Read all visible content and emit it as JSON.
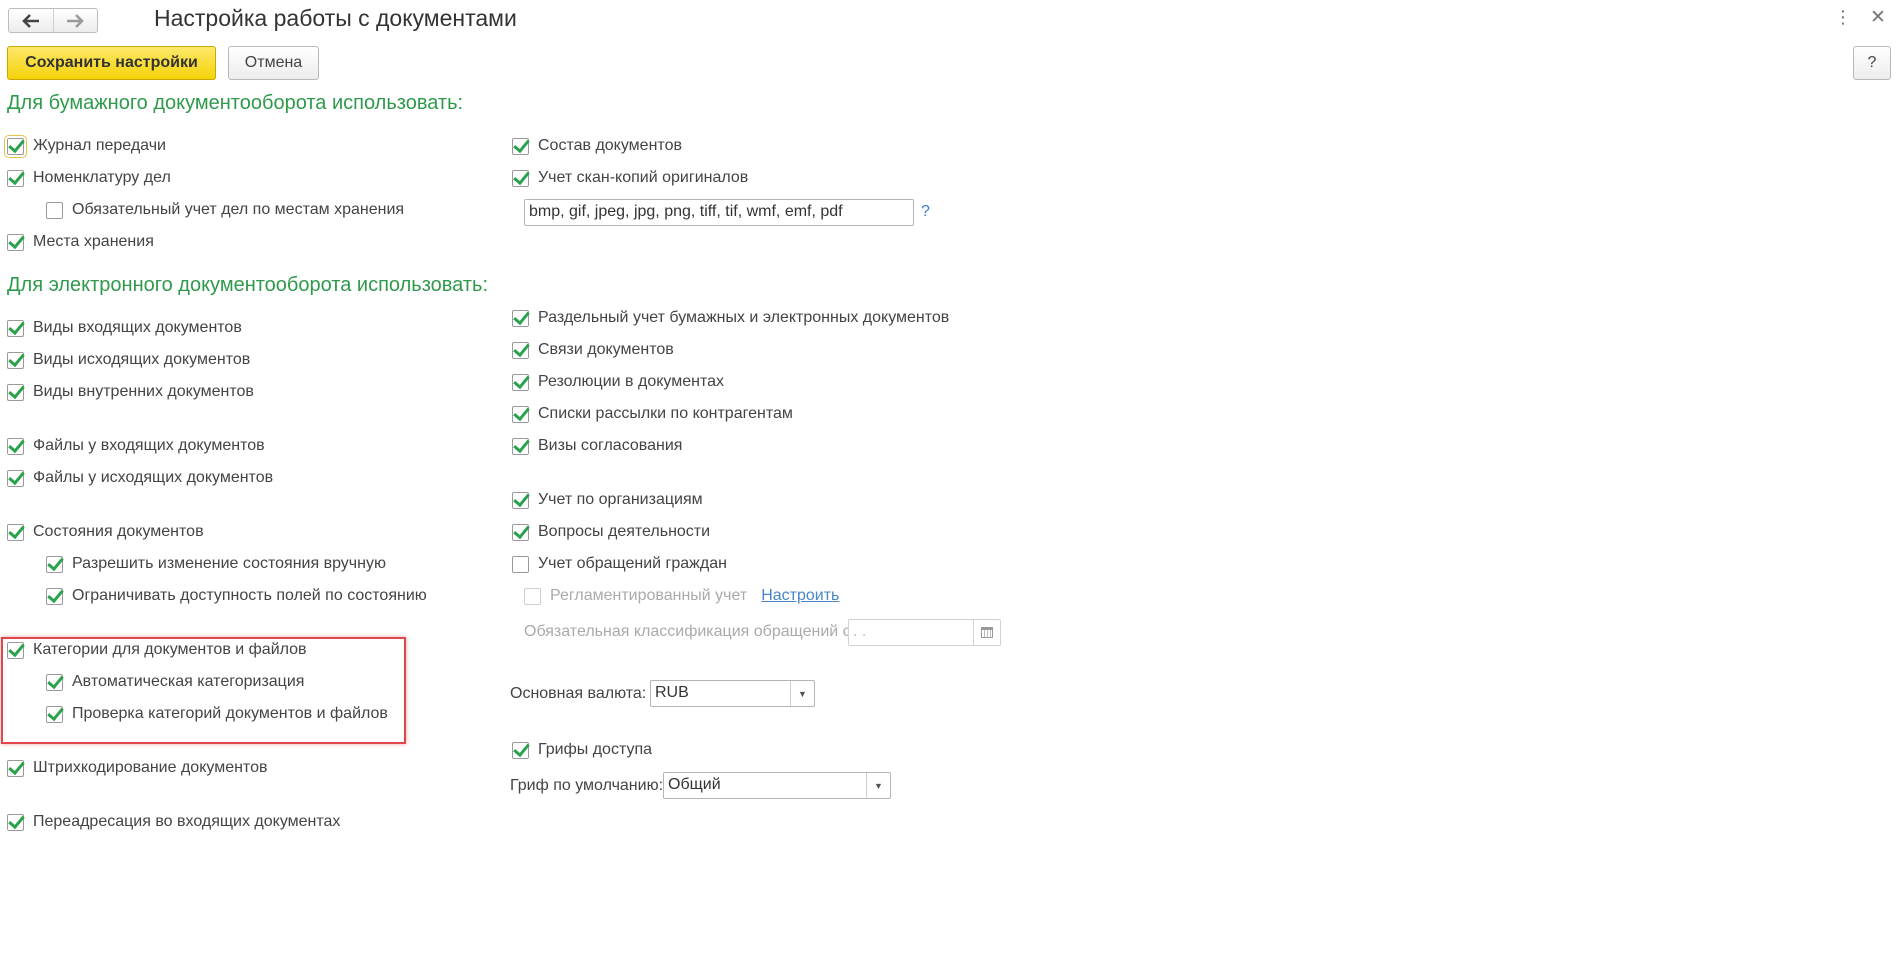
{
  "window": {
    "title": "Настройка работы с документами",
    "back_icon": "arrow-left-icon",
    "forward_icon": "arrow-right-icon",
    "more_icon": "⋮",
    "close_icon": "✕"
  },
  "toolbar": {
    "save_label": "Сохранить настройки",
    "cancel_label": "Отмена",
    "help_label": "?"
  },
  "paper": {
    "heading": "Для бумажного документооборота использовать:",
    "transfer_journal": "Журнал передачи",
    "cases_nomenclature": "Номенклатуру дел",
    "mandatory_storage_accounting": "Обязательный учет дел по местам хранения",
    "storage_places": "Места хранения",
    "documents_composition": "Состав документов",
    "scan_copies": "Учет скан-копий оригиналов",
    "extensions": "bmp, gif, jpeg, jpg, png, tiff, tif, wmf, emf, pdf",
    "extensions_help": "?"
  },
  "electronic": {
    "heading": "Для электронного документооборота использовать:",
    "incoming_types": "Виды входящих документов",
    "outgoing_types": "Виды исходящих документов",
    "internal_types": "Виды внутренних документов",
    "incoming_files": "Файлы у входящих документов",
    "outgoing_files": "Файлы у исходящих документов",
    "doc_states": "Состояния документов",
    "allow_manual_state": "Разрешить изменение состояния вручную",
    "restrict_fields_by_state": "Ограничивать доступность полей по состоянию",
    "categories": "Категории для документов и файлов",
    "auto_categorization": "Автоматическая категоризация",
    "check_categories": "Проверка категорий документов и файлов",
    "barcoding": "Штрихкодирование документов",
    "readdressing": "Переадресация во входящих документах",
    "separate_accounting": "Раздельный учет бумажных и электронных документов",
    "doc_links": "Связи документов",
    "resolutions": "Резолюции в документах",
    "mailing_lists": "Списки рассылки по контрагентам",
    "approval_visas": "Визы согласования",
    "org_accounting": "Учет по организациям",
    "activity_issues": "Вопросы деятельности",
    "citizen_appeals": "Учет обращений граждан",
    "regulated_accounting": "Регламентированный учет",
    "configure_link": "Настроить",
    "mandatory_classification_label": "Обязательная классификация обращений с:",
    "mandatory_classification_value": " .  .",
    "currency_label": "Основная валюта:",
    "currency_value": "RUB",
    "access_stamps": "Грифы доступа",
    "default_stamp_label": "Гриф по умолчанию:",
    "default_stamp_value": "Общий"
  },
  "colors": {
    "section_heading": "#2f9a4c",
    "checkmark": "#2aa14b",
    "save_button": "#f5d309",
    "highlight_border": "#e0474c",
    "link": "#4a86c7"
  }
}
